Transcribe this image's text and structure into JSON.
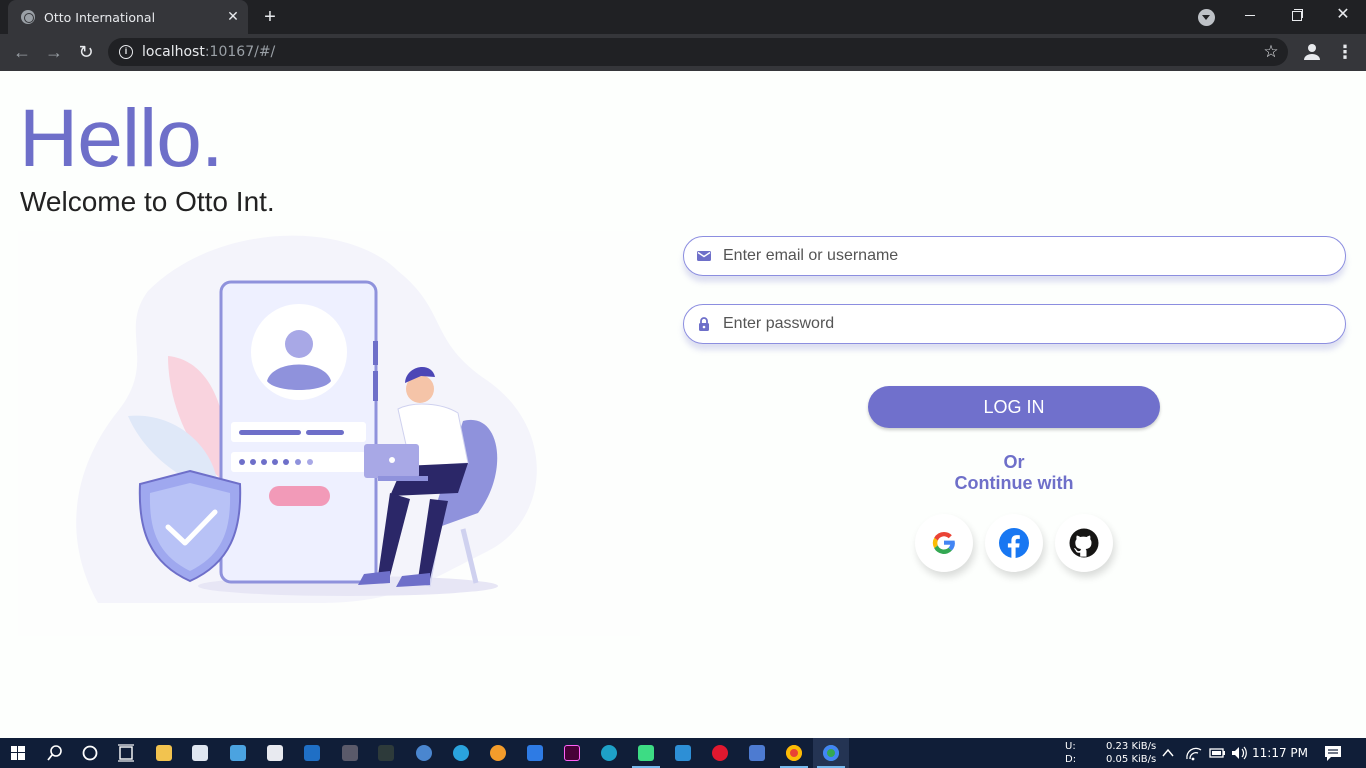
{
  "browser": {
    "tab_title": "Otto International",
    "tab_close": "✕",
    "new_tab": "+",
    "url_host": "localhost",
    "url_rest": ":10167/#/",
    "minimize": "",
    "maximize": "",
    "close": "✕"
  },
  "hero": {
    "title": "Hello.",
    "subtitle": "Welcome to Otto Int."
  },
  "form": {
    "email_placeholder": "Enter email or username",
    "email_value": "",
    "password_placeholder": "Enter password",
    "password_value": "",
    "login_label": "LOG IN",
    "or_label": "Or",
    "continue_label": "Continue with"
  },
  "social": [
    {
      "name": "google-icon"
    },
    {
      "name": "facebook-icon"
    },
    {
      "name": "github-icon"
    }
  ],
  "taskbar": {
    "upload_label": "U:",
    "download_label": "D:",
    "upload_speed": "0.23 KiB/s",
    "download_speed": "0.05 KiB/s",
    "time": "11:17 PM"
  },
  "colors": {
    "accent": "#6e6fc9",
    "button": "#7070cc",
    "chrome_dark": "#202124",
    "taskbar": "#101e38"
  }
}
